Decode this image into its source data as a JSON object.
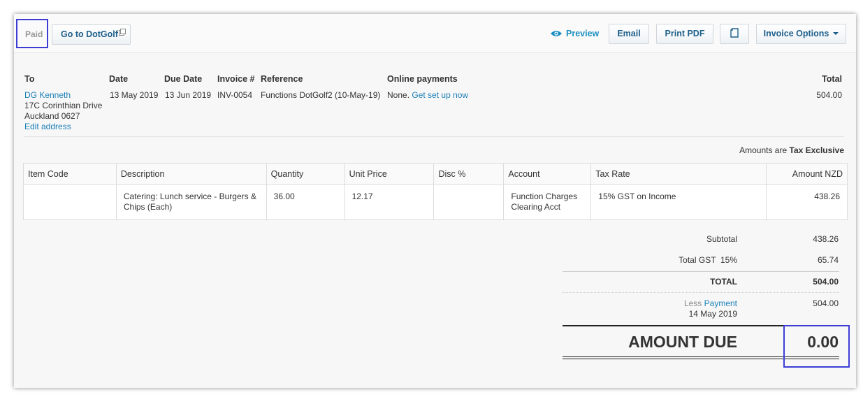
{
  "toolbar": {
    "status": "Paid",
    "goto_label": "Go to DotGolf",
    "preview_label": "Preview",
    "email_label": "Email",
    "print_pdf_label": "Print PDF",
    "invoice_options_label": "Invoice Options"
  },
  "invoice": {
    "headers": {
      "to": "To",
      "date": "Date",
      "due_date": "Due Date",
      "invoice_no": "Invoice #",
      "reference": "Reference",
      "online_payments": "Online payments",
      "total": "Total"
    },
    "contact_name": "DG Kenneth",
    "address_line1": "17C Corinthian Drive",
    "address_line2": "Auckland 0627",
    "edit_address": "Edit address",
    "date": "13 May 2019",
    "due_date": "13 Jun 2019",
    "invoice_no": "INV-0054",
    "reference": "Functions DotGolf2 (10-May-19)",
    "online_payments_status": "None.",
    "online_payments_link": "Get set up now",
    "total": "504.00",
    "amounts_are_prefix": "Amounts are",
    "amounts_are_value": "Tax Exclusive"
  },
  "line_table": {
    "columns": [
      "Item Code",
      "Description",
      "Quantity",
      "Unit Price",
      "Disc %",
      "Account",
      "Tax Rate",
      "Amount NZD"
    ],
    "rows": [
      {
        "item_code": "",
        "description": "Catering: Lunch service - Burgers & Chips (Each)",
        "quantity": "36.00",
        "unit_price": "12.17",
        "disc": "",
        "account": "Function Charges Clearing Acct",
        "tax_rate": "15% GST on Income",
        "amount": "438.26"
      }
    ]
  },
  "totals": {
    "subtotal_label": "Subtotal",
    "subtotal_value": "438.26",
    "gst_label": "Total GST  15%",
    "gst_value": "65.74",
    "total_label": "TOTAL",
    "total_value": "504.00",
    "less_label": "Less",
    "payment_link": "Payment",
    "payment_date": "14 May 2019",
    "payment_value": "504.00",
    "amount_due_label": "AMOUNT DUE",
    "amount_due_value": "0.00"
  },
  "icons": {
    "external": "external-link-icon",
    "preview": "eye-icon",
    "copy": "copy-icon",
    "dropdown": "chevron-down-icon"
  },
  "colors": {
    "link": "#1c7fb8",
    "highlight_box": "#3d3dd6",
    "button_text": "#1f5f8b"
  }
}
